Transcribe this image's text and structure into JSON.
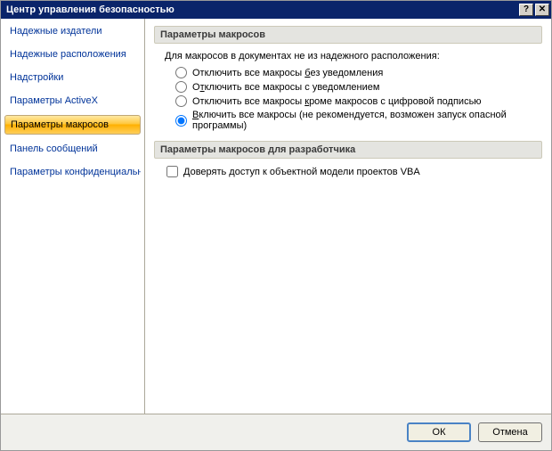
{
  "title": "Центр управления безопасностью",
  "sidebar": {
    "items": [
      {
        "label": "Надежные издатели"
      },
      {
        "label": "Надежные расположения"
      },
      {
        "label": "Надстройки"
      },
      {
        "label": "Параметры ActiveX"
      },
      {
        "label": "Параметры макросов"
      },
      {
        "label": "Панель сообщений"
      },
      {
        "label": "Параметры конфиденциальности"
      }
    ],
    "selected_index": 4
  },
  "section1": {
    "header": "Параметры макросов",
    "prompt": "Для макросов в документах не из надежного расположения:",
    "options": [
      {
        "text_before": "Отключить все макросы ",
        "u": "б",
        "text_after": "ез уведомления"
      },
      {
        "text_before": "О",
        "u": "т",
        "text_after": "ключить все макросы с уведомлением"
      },
      {
        "text_before": "Отключить все макросы ",
        "u": "к",
        "text_after": "роме макросов с цифровой подписью"
      },
      {
        "text_before": "",
        "u": "В",
        "text_after": "ключить все макросы (не рекомендуется, возможен запуск опасной программы)"
      }
    ],
    "selected_option": 3
  },
  "section2": {
    "header": "Параметры макросов для разработчика",
    "checkbox": {
      "label": "Доверять доступ к объектной модели проектов VBA",
      "checked": false
    }
  },
  "buttons": {
    "ok": "ОК",
    "cancel": "Отмена"
  }
}
